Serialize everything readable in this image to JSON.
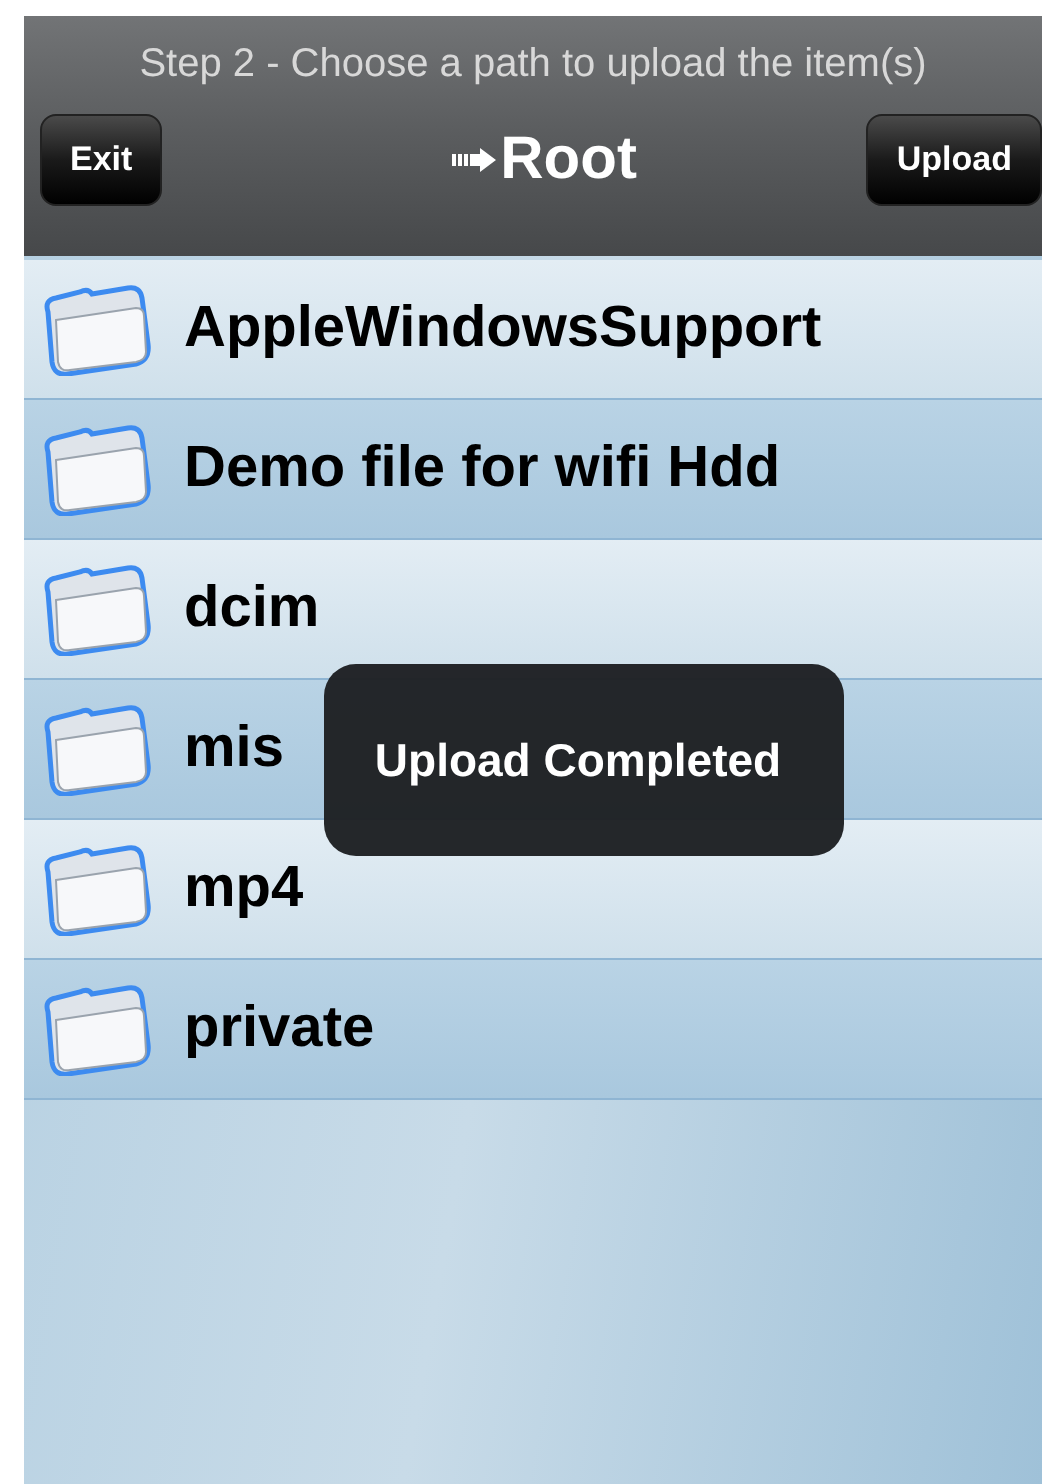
{
  "header": {
    "subtitle": "Step 2 - Choose a path to upload the item(s)",
    "left_button": "Exit",
    "title": "Root",
    "right_button": "Upload"
  },
  "folders": [
    {
      "name": "AppleWindowsSupport",
      "shaded": false
    },
    {
      "name": "Demo file for wifi Hdd",
      "shaded": true
    },
    {
      "name": "dcim",
      "shaded": false
    },
    {
      "name": "mis",
      "shaded": true
    },
    {
      "name": "mp4",
      "shaded": false
    },
    {
      "name": "private",
      "shaded": true
    }
  ],
  "toast": {
    "message": "Upload Completed"
  }
}
